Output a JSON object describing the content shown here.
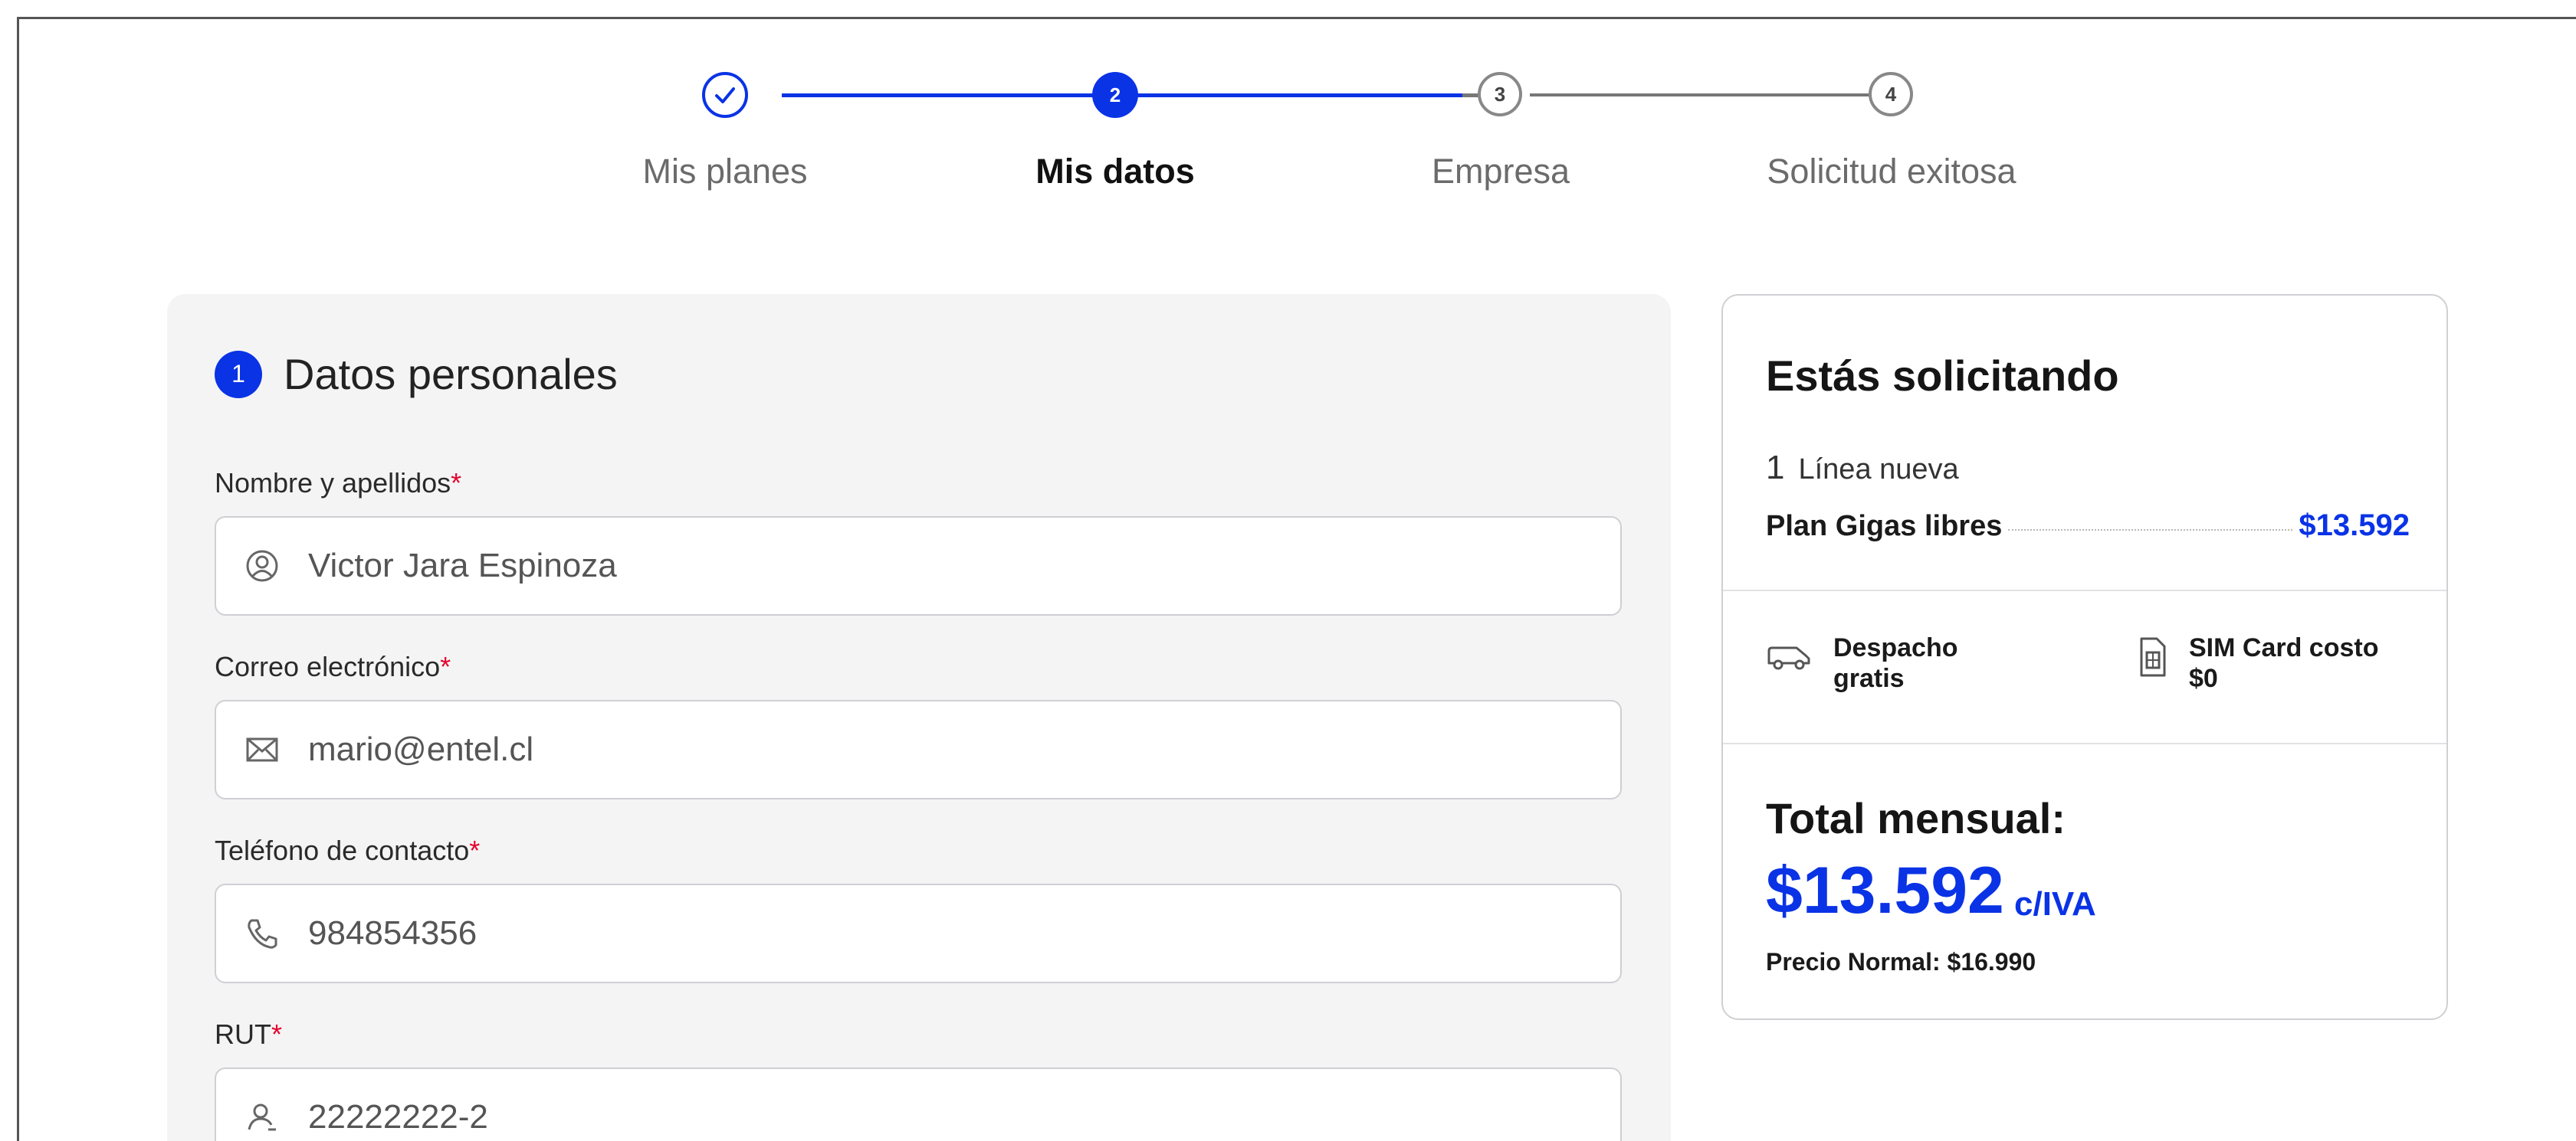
{
  "stepper": {
    "steps": [
      {
        "number": "",
        "label": "Mis planes",
        "state": "done"
      },
      {
        "number": "2",
        "label": "Mis datos",
        "state": "active"
      },
      {
        "number": "3",
        "label": "Empresa",
        "state": "pending"
      },
      {
        "number": "4",
        "label": "Solicitud exitosa",
        "state": "pending"
      }
    ]
  },
  "form": {
    "section_number": "1",
    "section_title": "Datos personales",
    "required_mark": "*",
    "fields": [
      {
        "label": "Nombre y apellidos",
        "value": "Victor Jara Espinoza",
        "icon": "user-circle-icon"
      },
      {
        "label": "Correo electrónico",
        "value": "mario@entel.cl",
        "icon": "mail-icon"
      },
      {
        "label": "Teléfono de contacto",
        "value": "984854356",
        "icon": "phone-icon"
      },
      {
        "label": "RUT",
        "value": "22222222-2",
        "icon": "id-user-icon"
      }
    ]
  },
  "summary": {
    "title": "Estás solicitando",
    "line_qty": "1",
    "line_text": "Línea nueva",
    "plan_name": "Plan Gigas libres",
    "plan_price": "$13.592",
    "shipping_line1": "Despacho",
    "shipping_line2": "gratis",
    "sim_line1": "SIM Card costo",
    "sim_line2": "$0",
    "total_label": "Total mensual:",
    "total_amount": "$13.592",
    "total_tax": "c/IVA",
    "normal_price": "Precio Normal: $16.990"
  },
  "colors": {
    "accent": "#0a33e6",
    "required": "#e4032e",
    "panel_bg": "#f4f4f5"
  }
}
